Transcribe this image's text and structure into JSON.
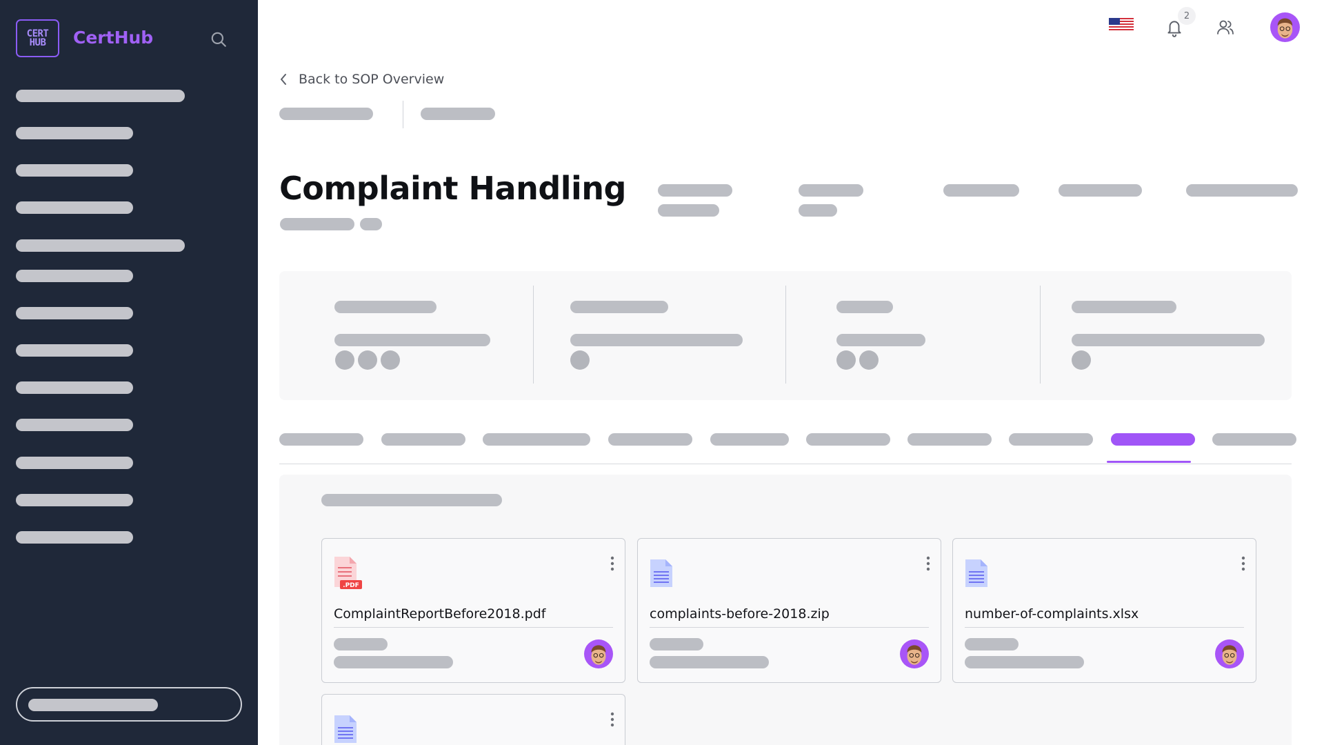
{
  "app": {
    "logo_line1": "CERT",
    "logo_line2": "HUB",
    "name": "CertHub"
  },
  "colors": {
    "sidebar_bg": "#1f2839",
    "accent": "#a055f7",
    "placeholder": "#bcbec4"
  },
  "header": {
    "notification_count": "2",
    "language": "en-US",
    "icons": [
      "search-icon",
      "bell-icon",
      "users-icon",
      "us-flag-icon"
    ]
  },
  "breadcrumb": {
    "back_label": "Back to SOP Overview"
  },
  "page": {
    "title": "Complaint Handling"
  },
  "tabs": {
    "count": 10,
    "active_index": 8
  },
  "files": [
    {
      "name": "ComplaintReportBefore2018.pdf",
      "type": "pdf",
      "badge": ".PDF"
    },
    {
      "name": "complaints-before-2018.zip",
      "type": "doc"
    },
    {
      "name": "number-of-complaints.xlsx",
      "type": "doc"
    },
    {
      "name": "",
      "type": "doc"
    }
  ]
}
